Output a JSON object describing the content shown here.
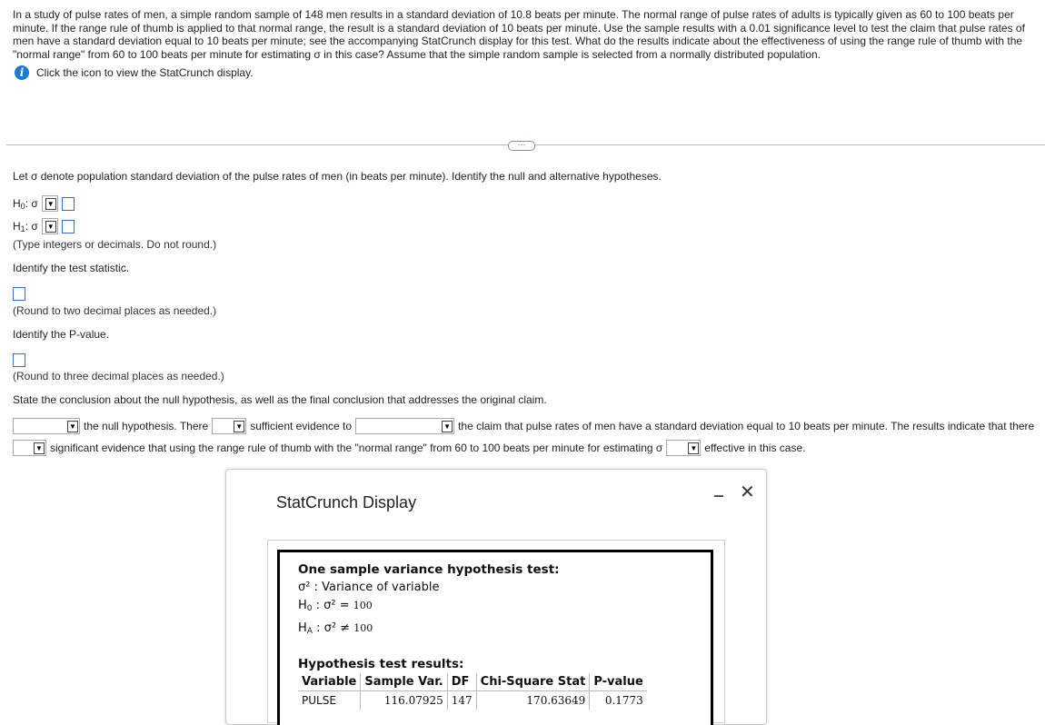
{
  "problem": {
    "text": "In a study of pulse rates of men, a simple random sample of 148 men results in a standard deviation of 10.8 beats per minute. The normal range of pulse rates of adults is typically given as 60 to 100 beats per minute. If the range rule of thumb is applied to that normal range, the result is a standard deviation of 10 beats per minute. Use the sample results with a 0.01 significance level to test the claim that pulse rates of men have a standard deviation equal to 10 beats per minute; see the accompanying StatCrunch display for this test. What do the results indicate about the effectiveness of using the range rule of thumb with the \"normal range\" from 60 to 100 beats per minute for estimating σ in this case? Assume that the simple random sample is selected from a normally distributed population.",
    "info_text": "Click the icon to view the StatCrunch display.",
    "more_label": "···"
  },
  "questions": {
    "intro": "Let σ denote population standard deviation of the pulse rates of men (in beats per minute). Identify the null and alternative hypotheses.",
    "h0_label": "H",
    "h0_sub": "0",
    "h1_label": "H",
    "h1_sub": "1",
    "sigma_suffix": ": σ",
    "hyp_note": "(Type integers or decimals. Do not round.)",
    "test_stat_prompt": "Identify the test statistic.",
    "test_stat_note": "(Round to two decimal places as needed.)",
    "pvalue_prompt": "Identify the P-value.",
    "pvalue_note": "(Round to three decimal places as needed.)",
    "conclusion_prompt": "State the conclusion about the null hypothesis, as well as the final conclusion that addresses the original claim.",
    "concl_1": "the null hypothesis. There",
    "concl_2": "sufficient evidence to",
    "concl_3": "the claim that pulse rates of men have a standard deviation equal to 10 beats per minute. The results indicate that there",
    "concl_4": "significant evidence that using the range rule of thumb with the \"normal range\" from 60 to 100 beats per minute for estimating σ",
    "concl_5": "effective in this case."
  },
  "statcrunch": {
    "title": "StatCrunch Display",
    "min_label": "‒",
    "close_label": "✕",
    "heading": "One sample variance hypothesis test:",
    "sigma2_line": "σ² : Variance of variable",
    "h0_line_pre": "H",
    "h0_line_sub": "0",
    "h0_line_mid": " : σ² = ",
    "h0_value": "100",
    "ha_line_pre": "H",
    "ha_line_sub": "A",
    "ha_line_mid": " : σ² ≠ ",
    "ha_value": "100",
    "results_heading": "Hypothesis test results:",
    "columns": [
      "Variable",
      "Sample Var.",
      "DF",
      "Chi-Square Stat",
      "P-value"
    ],
    "row": [
      "PULSE",
      "116.07925",
      "147",
      "170.63649",
      "0.1773"
    ]
  },
  "colors": {
    "accent": "#1a7ad4",
    "input_border": "#3a6cc9"
  }
}
